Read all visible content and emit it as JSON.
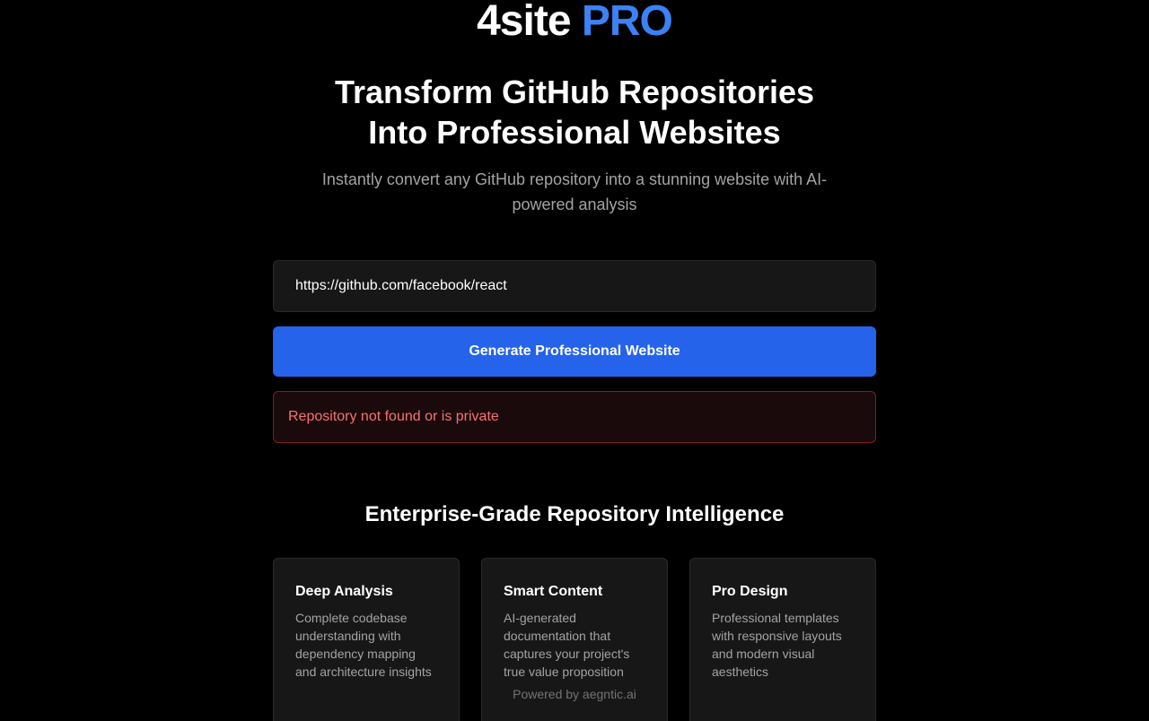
{
  "brand": {
    "name": "4site",
    "suffix": "PRO",
    "accent_color": "#3b82f6"
  },
  "hero": {
    "headline_line1": "Transform GitHub Repositories",
    "headline_line2": "Into Professional Websites",
    "subtitle": "Instantly convert any GitHub repository into a stunning website with AI-powered analysis"
  },
  "form": {
    "repo_url_value": "https://github.com/facebook/react",
    "submit_label": "Generate Professional Website",
    "button_color": "#2563eb",
    "error_message": "Repository not found or is private",
    "error_color": "#f87171"
  },
  "features": {
    "section_title": "Enterprise-Grade Repository Intelligence",
    "cards": [
      {
        "title": "Deep Analysis",
        "description": "Complete codebase understanding with dependency mapping and architecture insights"
      },
      {
        "title": "Smart Content",
        "description": "AI-generated documentation that captures your project's true value proposition"
      },
      {
        "title": "Pro Design",
        "description": "Professional templates with responsive layouts and modern visual aesthetics"
      }
    ]
  },
  "footer": {
    "powered_by": "Powered by aegntic.ai"
  }
}
